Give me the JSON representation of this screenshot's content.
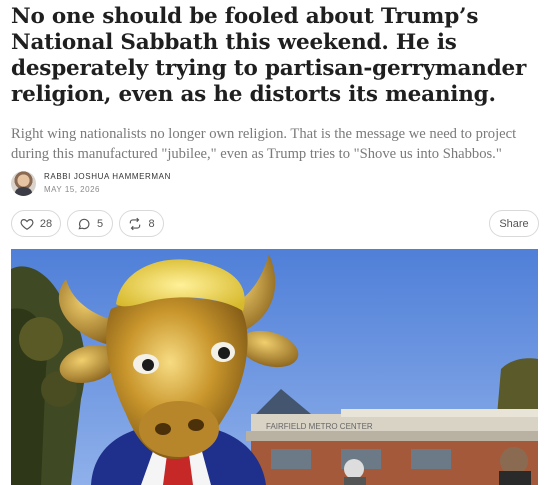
{
  "post": {
    "title": "No one should be fooled about Trump’s National Sabbath this weekend. He is desperately trying to partisan-gerrymander religion, even as he distorts its meaning.",
    "subtitle": "Right wing nationalists no longer own religion. That is the message we need to project during this manufactured \"jubilee,\" even as Trump tries to \"Shove us into Shabbos.\"",
    "author": "RABBI JOSHUA HAMMERMAN",
    "date": "MAY 15, 2026"
  },
  "actions": {
    "like_count": "28",
    "comment_count": "5",
    "restack_count": "8",
    "share_label": "Share"
  },
  "hero_image": {
    "sign_text": "FAIRFIELD METRO CENTER"
  }
}
